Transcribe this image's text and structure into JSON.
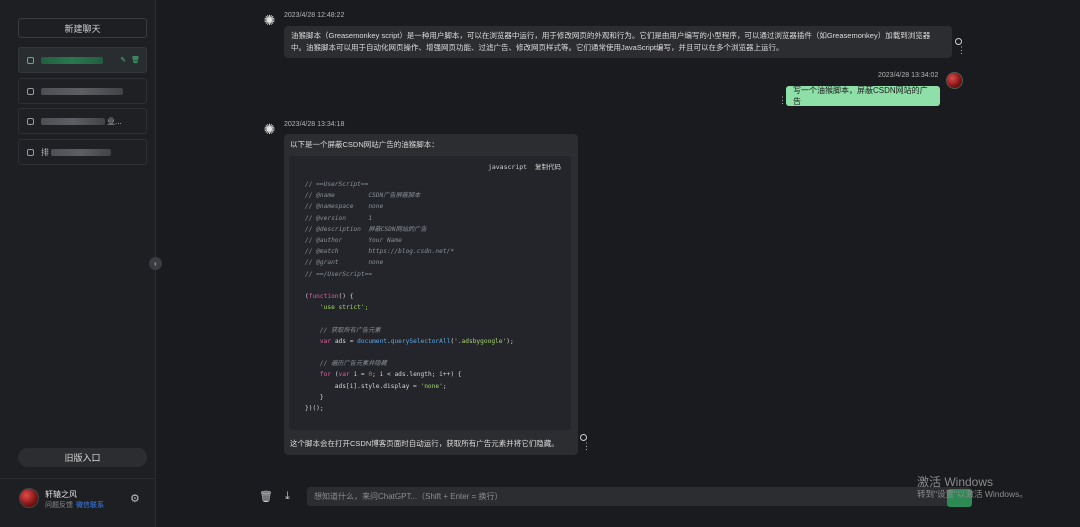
{
  "sidebar": {
    "new_chat_label": "新建聊天",
    "old_entry_label": "旧版入口",
    "conversations": [
      {
        "title_visible": "",
        "active": true
      },
      {
        "title_visible": ""
      },
      {
        "title_visible": "业..."
      },
      {
        "title_visible": "排"
      }
    ],
    "user": {
      "name": "轩辕之风",
      "feedback_label": "问题反馈",
      "contact_label": "微信联系"
    }
  },
  "messages": [
    {
      "role": "assistant",
      "timestamp": "2023/4/28 12:48:22",
      "text": "油猴脚本（Greasemonkey script）是一种用户脚本，可以在浏览器中运行，用于修改网页的外观和行为。它们是由用户编写的小型程序，可以通过浏览器插件（如Greasemonkey）加载到浏览器中。油猴脚本可以用于自动化网页操作、增强网页功能、过滤广告、修改网页样式等。它们通常使用JavaScript编写，并且可以在多个浏览器上运行。"
    },
    {
      "role": "user",
      "timestamp": "2023/4/28 13:34:02",
      "text": "写一个油猴脚本，屏蔽CSDN网站的广告"
    },
    {
      "role": "assistant",
      "timestamp": "2023/4/28 13:34:18",
      "intro": "以下是一个屏蔽CSDN网站广告的油猴脚本：",
      "code_lang": "javascript",
      "copy_label": "复制代码",
      "outro": "这个脚本会在打开CSDN博客页面时自动运行，获取所有广告元素并将它们隐藏。"
    }
  ],
  "code": {
    "header_lines": [
      [
        "// ==UserScript==",
        ""
      ],
      [
        "// @name",
        "CSDN广告屏蔽脚本"
      ],
      [
        "// @namespace",
        "none"
      ],
      [
        "// @version",
        "1"
      ],
      [
        "// @description",
        "屏蔽CSDN网站的广告"
      ],
      [
        "// @author",
        "Your Name"
      ],
      [
        "// @match",
        "https://blog.csdn.net/*"
      ],
      [
        "// @grant",
        "none"
      ],
      [
        "// ==/UserScript==",
        ""
      ]
    ],
    "comment_get_ads": "// 获取所有广告元素",
    "comment_loop": "// 遍历广告元素并隐藏",
    "selector": "'.adsbygoogle'",
    "display_value": "'none'",
    "use_strict": "'use strict';"
  },
  "input": {
    "placeholder": "想知道什么，来问ChatGPT...（Shift + Enter = 换行）"
  },
  "watermark": {
    "line1": "激活 Windows",
    "line2": "转到\"设置\"以激活 Windows。"
  },
  "colors": {
    "user_bubble": "#8fe0a8",
    "accent": "#3fbf7f",
    "link": "#3b82f6"
  }
}
